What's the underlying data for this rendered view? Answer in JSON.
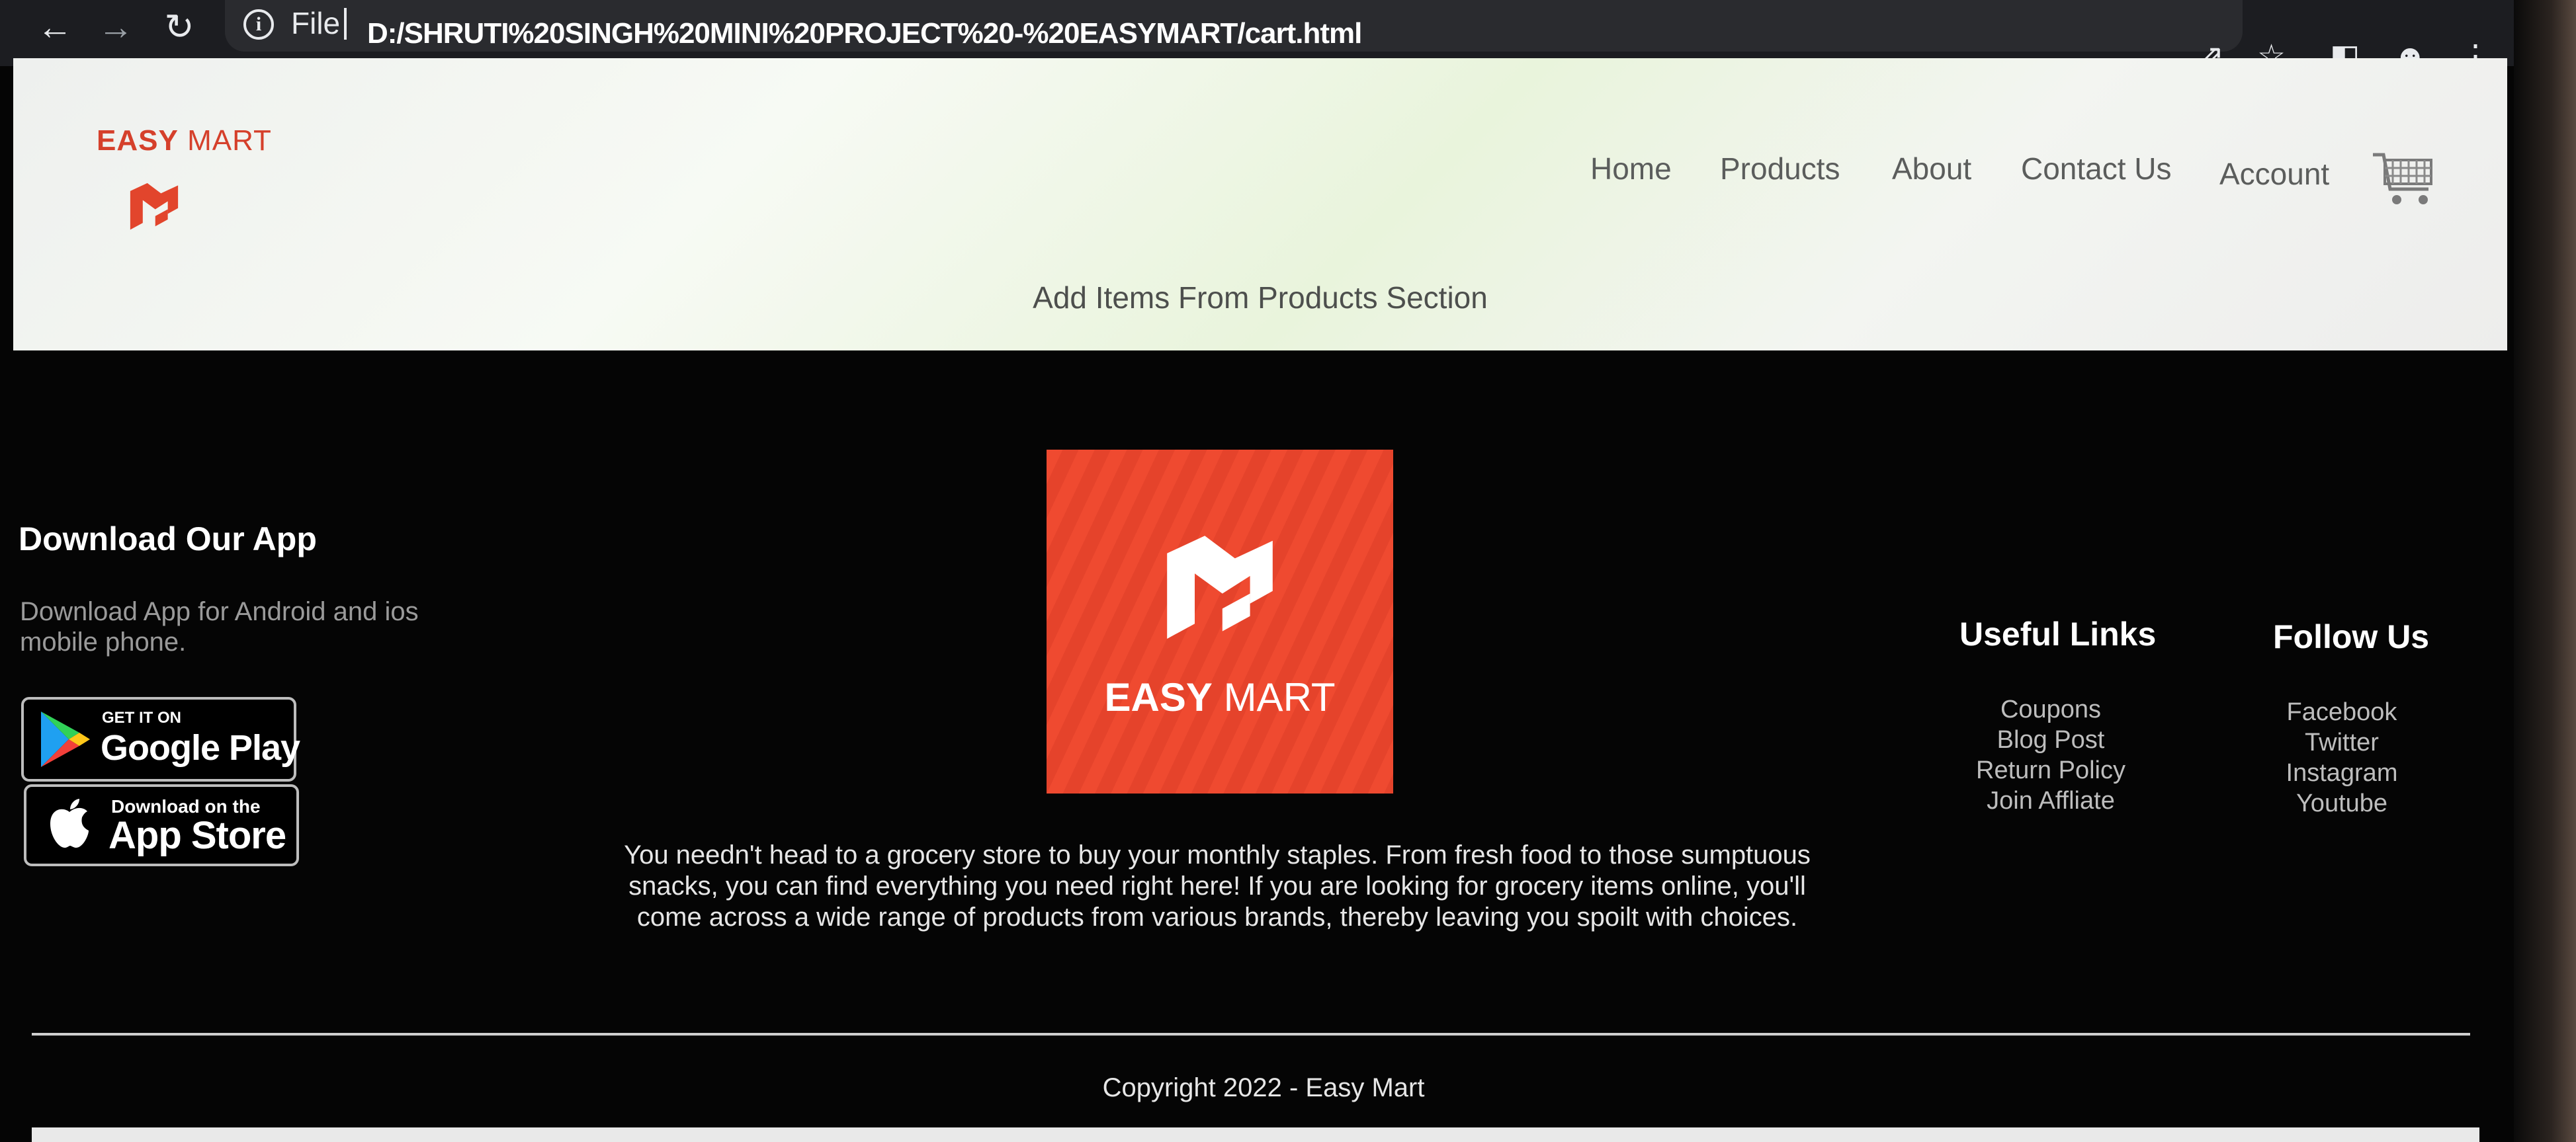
{
  "browser": {
    "back_icon": "arrow-left-icon",
    "forward_icon": "arrow-right-icon",
    "reload_icon": "reload-icon",
    "scheme_label": "File",
    "url": "D:/SHRUTI%20SINGH%20MINI%20PROJECT%20-%20EASYMART/cart.html",
    "toolbar_icons": [
      "share-icon",
      "star-icon",
      "sidepanel-icon",
      "profile-icon",
      "more-icon"
    ]
  },
  "header": {
    "logo_bold": "EASY",
    "logo_light": "MART",
    "nav": [
      "Home",
      "Products",
      "About",
      "Contact Us",
      "Account"
    ],
    "cart_icon": "cart-icon",
    "empty_message": "Add Items From Products Section",
    "brand_color": "#e94b31"
  },
  "footer": {
    "app": {
      "title": "Download Our App",
      "text": "Download App for Android and ios mobile phone.",
      "google_small": "GET IT ON",
      "google_big": "Google Play",
      "apple_small": "Download on the",
      "apple_big": "App Store"
    },
    "center": {
      "logo_bold": "EASY",
      "logo_light": "MART",
      "about": "You needn't head to a grocery store to buy your monthly staples. From fresh food to those sumptuous snacks, you can find everything you need right here! If you are looking for grocery items online, you'll come across a wide range of products from various brands, thereby leaving you spoilt with choices."
    },
    "useful_links": {
      "title": "Useful Links",
      "items": [
        "Coupons",
        "Blog Post",
        "Return Policy",
        "Join Affliate"
      ]
    },
    "follow_us": {
      "title": "Follow Us",
      "items": [
        "Facebook",
        "Twitter",
        "Instagram",
        "Youtube"
      ]
    },
    "copyright": "Copyright 2022 - Easy Mart"
  }
}
